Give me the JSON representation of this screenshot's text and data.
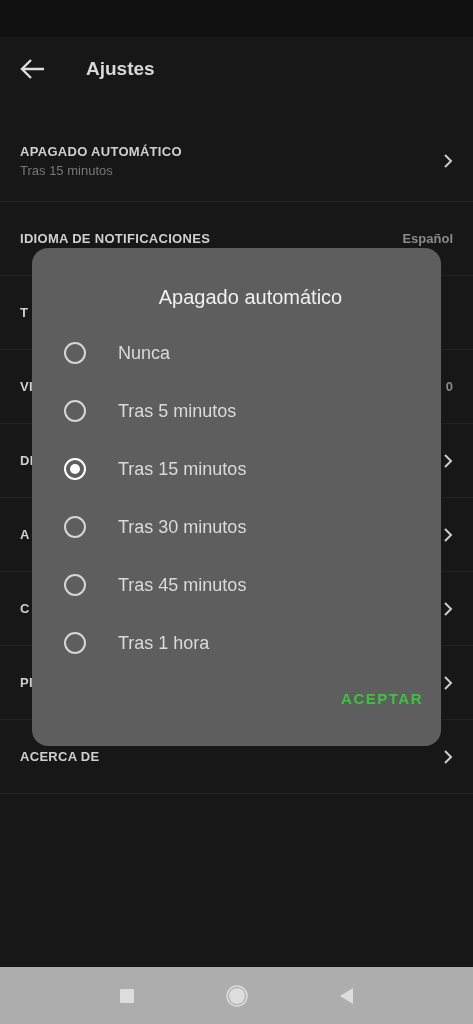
{
  "app_bar": {
    "title": "Ajustes"
  },
  "settings": [
    {
      "label": "APAGADO AUTOMÁTICO",
      "subtitle": "Tras 15 minutos",
      "chevron": true
    },
    {
      "label": "IDIOMA DE NOTIFICACIONES",
      "value": "Español"
    },
    {
      "label": "T"
    },
    {
      "label": "VI",
      "value": "0"
    },
    {
      "label": "DI",
      "chevron": true
    },
    {
      "label": "A",
      "chevron": true
    },
    {
      "label": "C",
      "chevron": true
    },
    {
      "label": "PI",
      "chevron": true
    },
    {
      "label": "ACERCA DE",
      "chevron": true
    }
  ],
  "dialog": {
    "title": "Apagado automático",
    "options": [
      {
        "label": "Nunca",
        "selected": false
      },
      {
        "label": "Tras 5 minutos",
        "selected": false
      },
      {
        "label": "Tras 15 minutos",
        "selected": true
      },
      {
        "label": "Tras 30 minutos",
        "selected": false
      },
      {
        "label": "Tras 45 minutos",
        "selected": false
      },
      {
        "label": "Tras 1 hora",
        "selected": false
      }
    ],
    "button": "ACEPTAR"
  }
}
